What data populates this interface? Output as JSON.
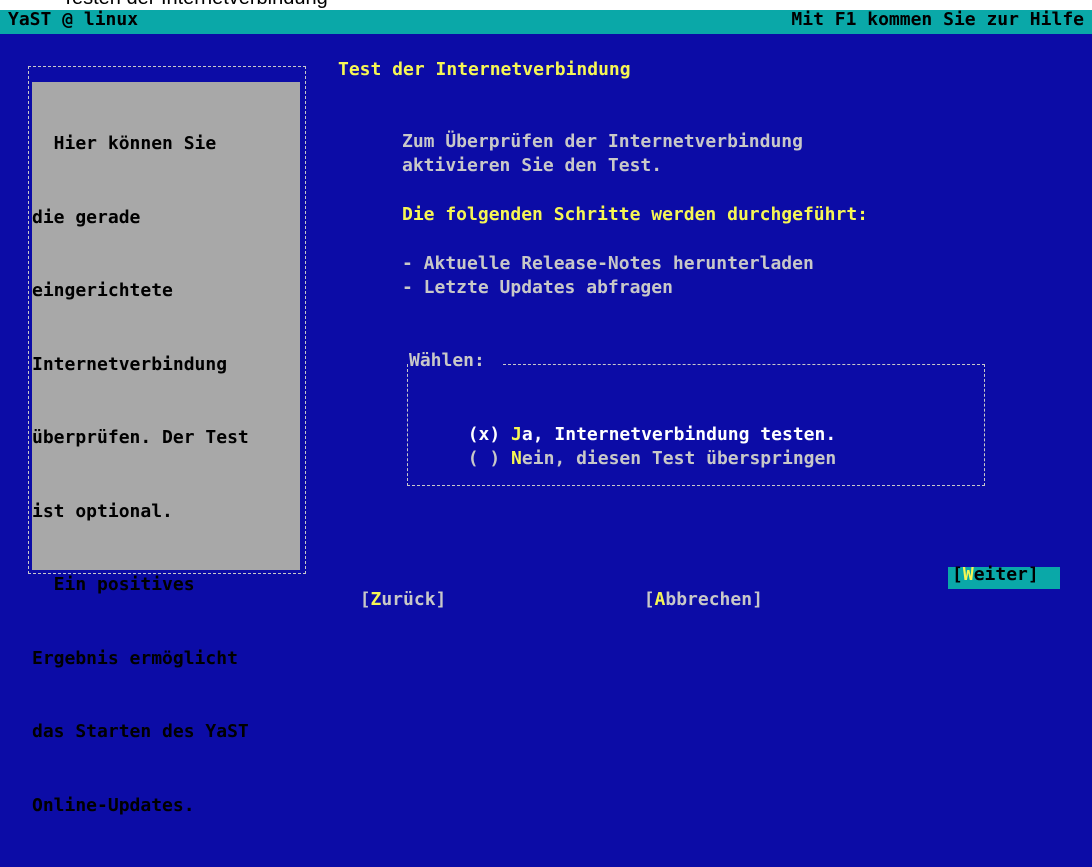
{
  "outer": {
    "caption": "Testen der Internetverbindung"
  },
  "titlebar": {
    "left": "YaST @ linux",
    "right": "Mit F1 kommen Sie zur Hilfe"
  },
  "help": {
    "lines": [
      "  Hier können Sie",
      "die gerade",
      "eingerichtete",
      "Internetverbindung",
      "überprüfen. Der Test",
      "ist optional.",
      "  Ein positives",
      "Ergebnis ermöglicht",
      "das Starten des YaST",
      "Online-Updates."
    ]
  },
  "main": {
    "heading": "Test der Internetverbindung",
    "intro_line1": "Zum Überprüfen der Internetverbindung",
    "intro_line2": "aktivieren Sie den Test.",
    "steps_title": "Die folgenden Schritte werden durchgeführt:",
    "step1": "- Aktuelle Release-Notes herunterladen",
    "step2": "- Letzte Updates abfragen"
  },
  "choice": {
    "legend": "Wählen:",
    "option_yes": {
      "marker": "(x) ",
      "hotkey": "J",
      "rest": "a, Internetverbindung testen.",
      "selected": true
    },
    "option_no": {
      "marker": "( ) ",
      "hotkey": "N",
      "rest": "ein, diesen Test überspringen",
      "selected": false
    }
  },
  "buttons": {
    "back": {
      "open": "[",
      "hotkey": "Z",
      "rest": "urück]"
    },
    "abort": {
      "open": "[",
      "hotkey": "A",
      "rest": "bbrechen]"
    },
    "next": {
      "open": "[",
      "hotkey": "W",
      "rest": "eiter]"
    }
  },
  "colors": {
    "background": "#0c0ca6",
    "accent": "#0aa8a8",
    "highlight": "#f6f654",
    "help_panel": "#a8a8a8"
  }
}
